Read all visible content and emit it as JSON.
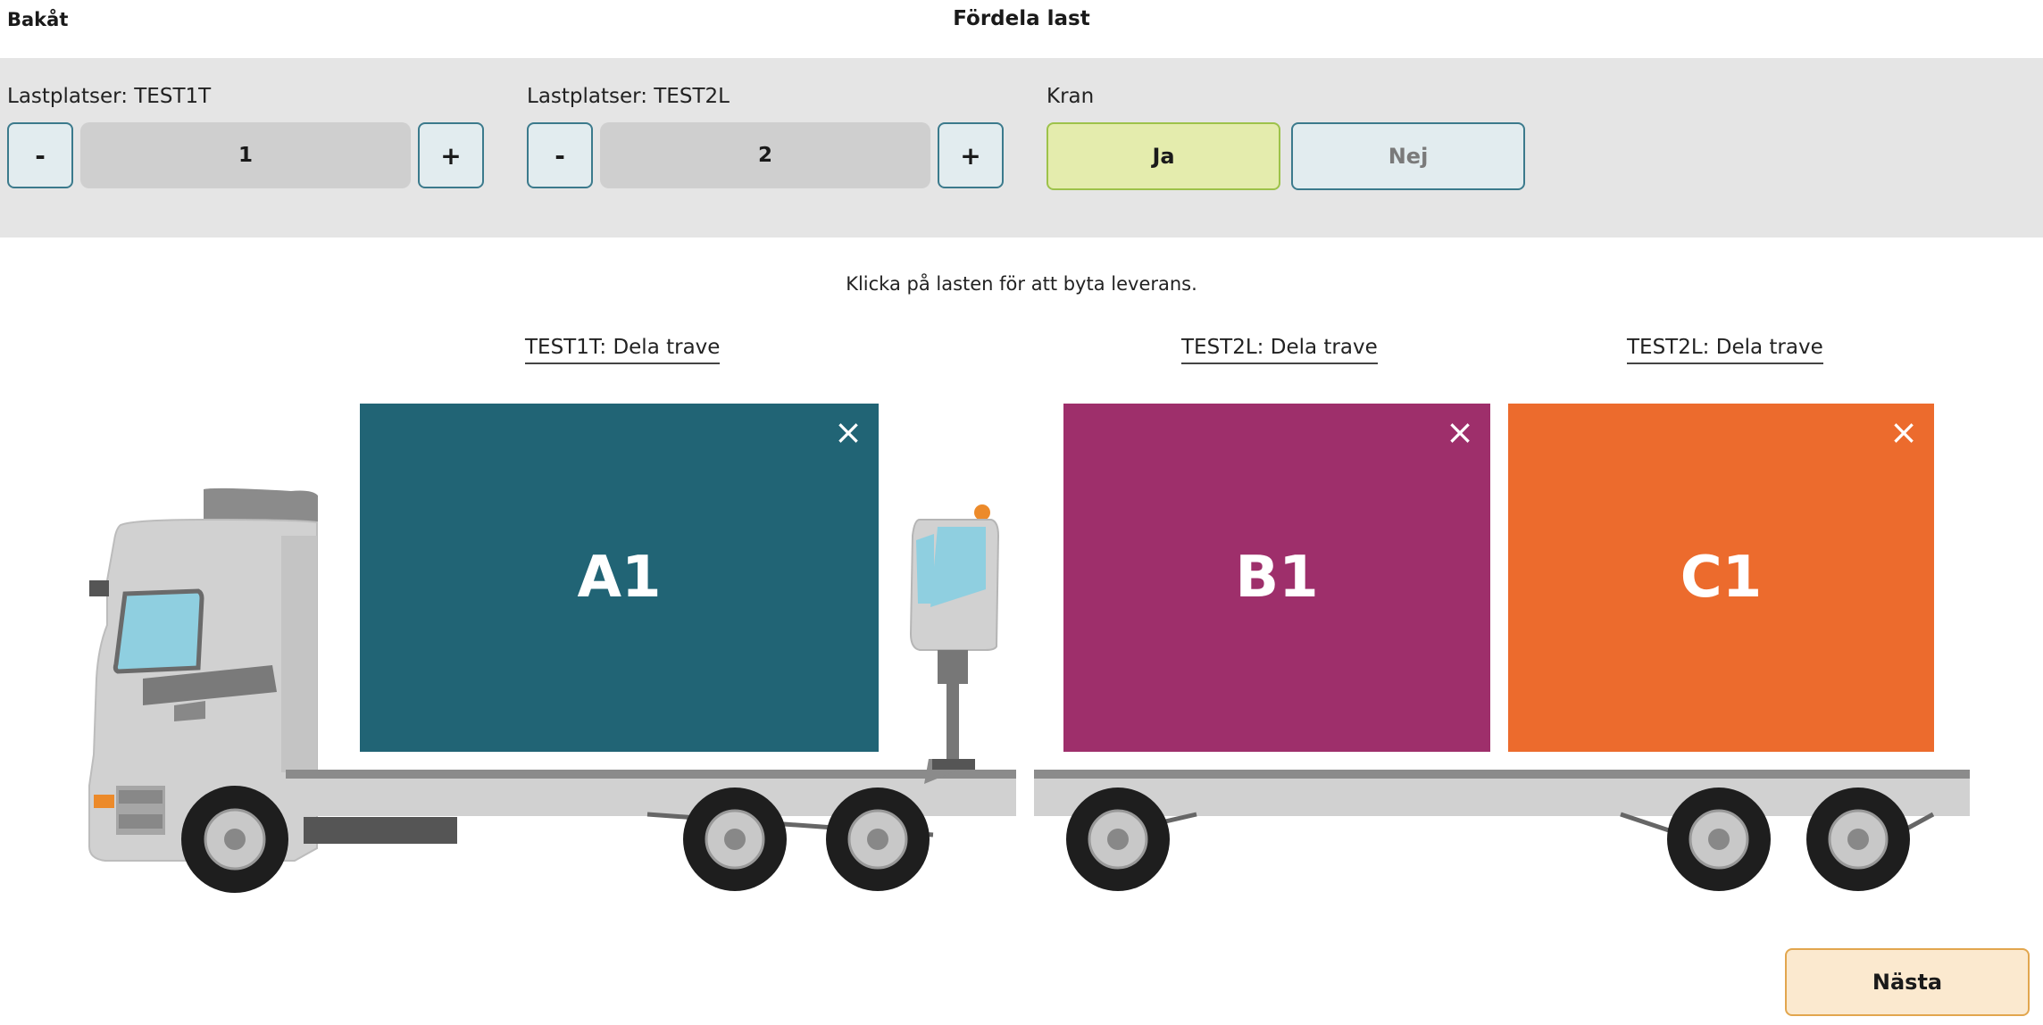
{
  "header": {
    "back_label": "Bakåt",
    "title": "Fördela last"
  },
  "controls": {
    "stepper1": {
      "label": "Lastplatser: TEST1T",
      "minus": "-",
      "plus": "+",
      "value": "1"
    },
    "stepper2": {
      "label": "Lastplatser: TEST2L",
      "minus": "-",
      "plus": "+",
      "value": "2"
    },
    "crane": {
      "label": "Kran",
      "yes": "Ja",
      "no": "Nej",
      "selected": "Ja"
    }
  },
  "hint": "Klicka på lasten för att byta leverans.",
  "cargo": [
    {
      "label": "TEST1T: Dela trave",
      "id": "A1",
      "color": "#216475",
      "close": "×"
    },
    {
      "label": "TEST2L: Dela trave",
      "id": "B1",
      "color": "#9e2f6b",
      "close": "×"
    },
    {
      "label": "TEST2L: Dela trave",
      "id": "C1",
      "color": "#ec6b2d",
      "close": "×"
    }
  ],
  "footer": {
    "next_label": "Nästa"
  }
}
